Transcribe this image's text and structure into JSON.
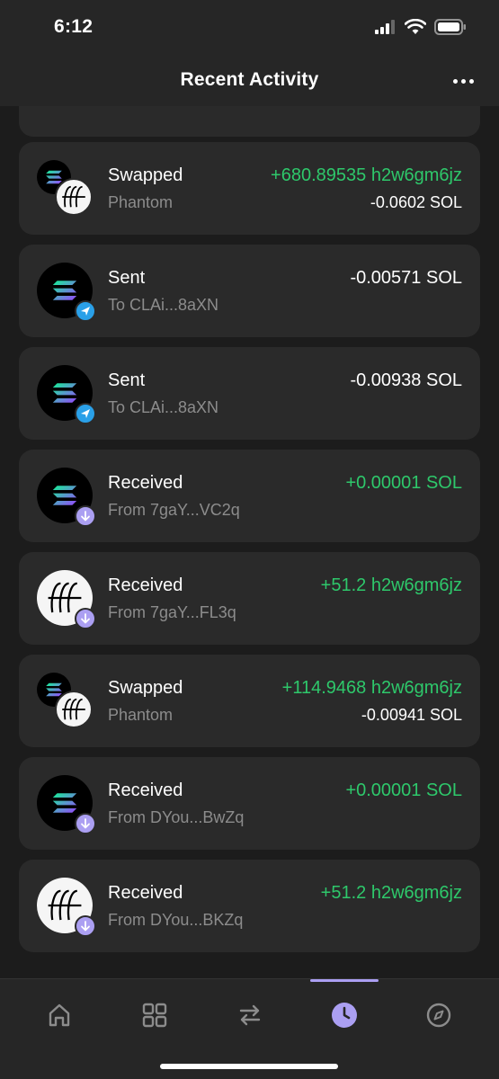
{
  "status_bar": {
    "time": "6:12"
  },
  "header": {
    "title": "Recent Activity"
  },
  "colors": {
    "positive": "#2ec86b",
    "accent": "#ab9ff2",
    "send_badge": "#2aa0e8",
    "secondary_text": "#8c8c8c",
    "card_bg": "#2a2a2a"
  },
  "activity": [
    {
      "type": "swap",
      "title": "Swapped",
      "subtitle": "Phantom",
      "amount": "+680.89535 h2w6gm6jz",
      "amount2": "-0.0602 SOL"
    },
    {
      "type": "sent",
      "title": "Sent",
      "subtitle": "To CLAi...8aXN",
      "amount": "-0.00571 SOL"
    },
    {
      "type": "sent",
      "title": "Sent",
      "subtitle": "To CLAi...8aXN",
      "amount": "-0.00938 SOL"
    },
    {
      "type": "received-sol",
      "title": "Received",
      "subtitle": "From 7gaY...VC2q",
      "amount": "+0.00001 SOL"
    },
    {
      "type": "received-token",
      "title": "Received",
      "subtitle": "From 7gaY...FL3q",
      "amount": "+51.2 h2w6gm6jz"
    },
    {
      "type": "swap",
      "title": "Swapped",
      "subtitle": "Phantom",
      "amount": "+114.9468 h2w6gm6jz",
      "amount2": "-0.00941 SOL"
    },
    {
      "type": "received-sol",
      "title": "Received",
      "subtitle": "From DYou...BwZq",
      "amount": "+0.00001 SOL"
    },
    {
      "type": "received-token",
      "title": "Received",
      "subtitle": "From DYou...BKZq",
      "amount": "+51.2 h2w6gm6jz"
    }
  ],
  "tabs": [
    {
      "icon": "home-icon"
    },
    {
      "icon": "grid-icon"
    },
    {
      "icon": "swap-arrows-icon"
    },
    {
      "icon": "clock-icon",
      "active": true
    },
    {
      "icon": "compass-icon"
    }
  ]
}
